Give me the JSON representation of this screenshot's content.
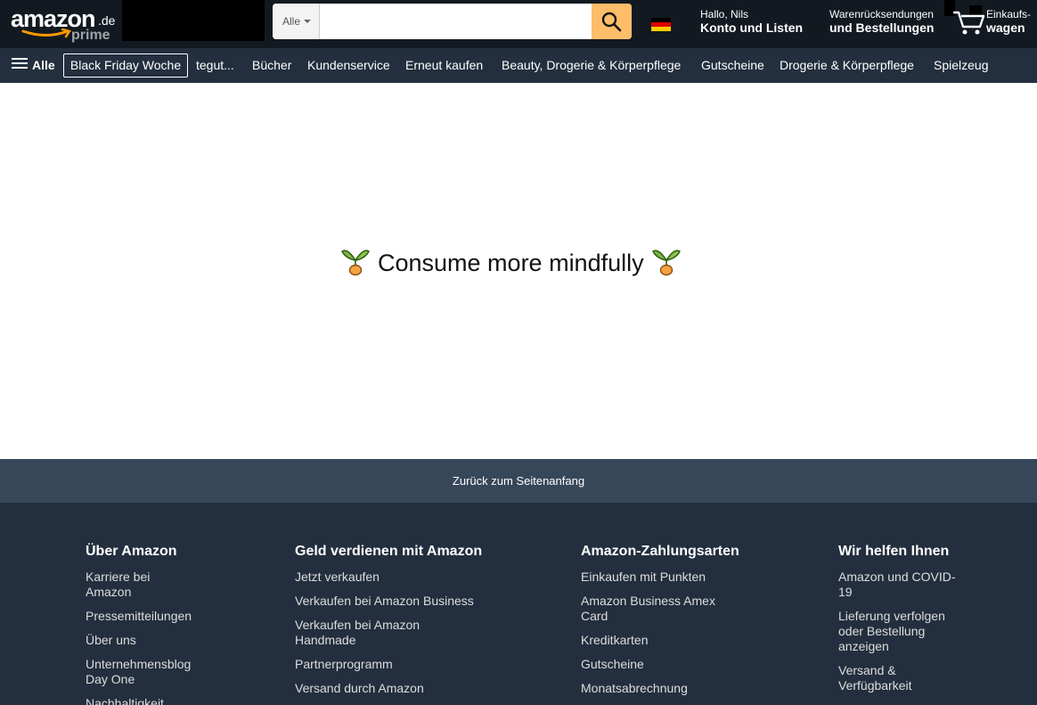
{
  "header": {
    "logo": {
      "word": "amazon",
      "tld": ".de",
      "sub": "prime"
    },
    "search": {
      "category": "Alle",
      "placeholder": "",
      "value": ""
    },
    "account": {
      "greeting": "Hallo, Nils",
      "label": "Konto und Listen"
    },
    "returns": {
      "line1": "Warenrücksendungen",
      "line2": "und Bestellungen"
    },
    "cart": {
      "line1": "Einkaufs-",
      "line2": "wagen"
    },
    "colors": {
      "bg": "#131921",
      "search_button": "#febd69",
      "nav_bg": "#232f3e"
    }
  },
  "nav": {
    "all": "Alle",
    "items": [
      "Black Friday Woche",
      "tegut...",
      "Bücher",
      "Kundenservice",
      "Erneut kaufen",
      "Beauty, Drogerie & Körperpflege",
      "Gutscheine",
      "Drogerie & Körperpflege",
      "Spielzeug"
    ]
  },
  "main": {
    "message": "Consume more mindfully",
    "icon": "sprout-icon"
  },
  "footer": {
    "back_to_top": "Zurück zum Seitenanfang",
    "columns": [
      {
        "title": "Über Amazon",
        "links": [
          "Karriere bei\nAmazon",
          "Pressemitteilungen",
          "Über uns",
          "Unternehmensblog\nDay One",
          "Nachhaltigkeit"
        ]
      },
      {
        "title": "Geld verdienen mit Amazon",
        "links": [
          "Jetzt verkaufen",
          "Verkaufen bei Amazon Business",
          "Verkaufen bei Amazon\nHandmade",
          "Partnerprogramm",
          "Versand durch Amazon"
        ]
      },
      {
        "title": "Amazon-Zahlungsarten",
        "links": [
          "Einkaufen mit Punkten",
          "Amazon Business Amex\nCard",
          "Kreditkarten",
          "Gutscheine",
          "Monatsabrechnung"
        ]
      },
      {
        "title": "Wir helfen Ihnen",
        "links": [
          "Amazon und COVID-\n19",
          "Lieferung verfolgen\noder Bestellung\nanzeigen",
          "Versand &\nVerfügbarkeit"
        ]
      }
    ]
  }
}
